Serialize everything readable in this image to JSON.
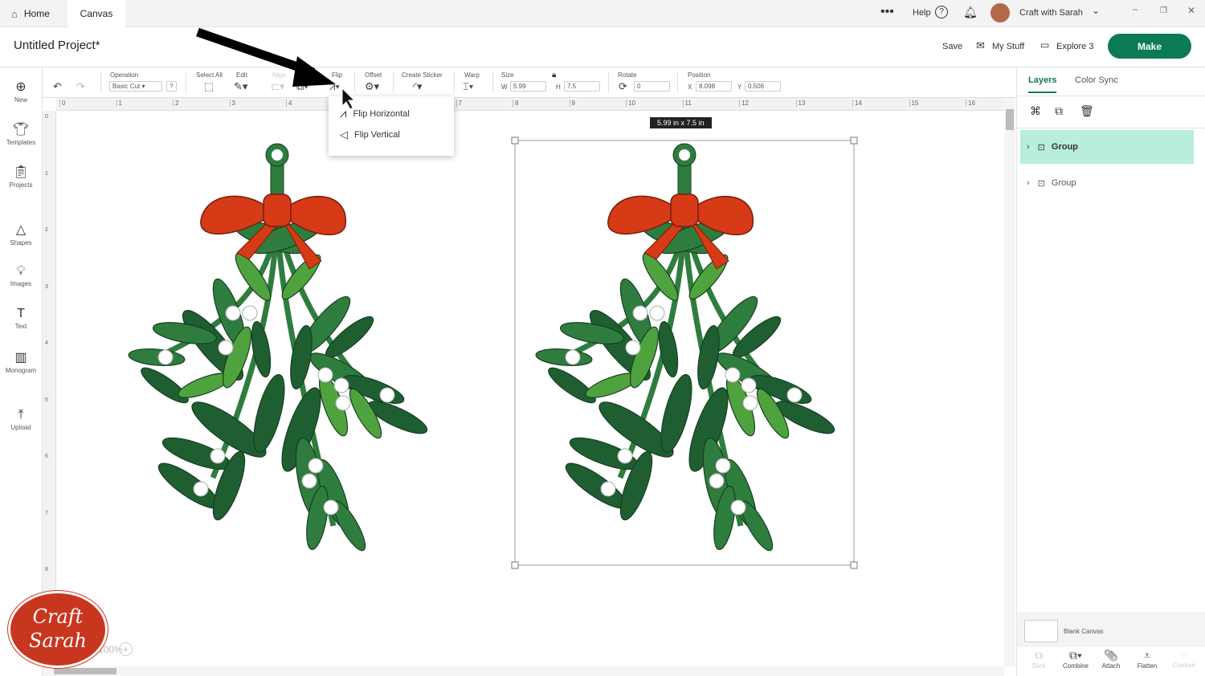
{
  "tabs": [
    {
      "label": "Home"
    },
    {
      "label": "Canvas"
    }
  ],
  "topbar": {
    "help": "Help",
    "user": "Craft with Sarah"
  },
  "header": {
    "title": "Untitled Project*",
    "save": "Save",
    "my_stuff": "My Stuff",
    "machine": "Explore 3",
    "make": "Make"
  },
  "toolbar": {
    "operation_label": "Operation",
    "operation_value": "Basic Cut",
    "help": "?",
    "select_all": "Select All",
    "edit": "Edit",
    "align": "Align",
    "flip": "Flip",
    "offset": "Offset",
    "create_sticker": "Create Sticker",
    "warp": "Warp",
    "size": "Size",
    "w_label": "W",
    "w": "5.99",
    "h_label": "H",
    "h": "7.5",
    "rotate": "Rotate",
    "rotate_value": "0",
    "position": "Position",
    "x_label": "X",
    "x": "8.098",
    "y_label": "Y",
    "y": "0.506"
  },
  "flip_menu": {
    "items": [
      {
        "label": "Flip Horizontal"
      },
      {
        "label": "Flip Vertical"
      }
    ]
  },
  "sidebar": {
    "items": [
      {
        "label": "New",
        "icon": "plus-circle"
      },
      {
        "label": "Templates",
        "icon": "shirt"
      },
      {
        "label": "Projects",
        "icon": "clipboard"
      },
      {
        "label": "Shapes",
        "icon": "shapes"
      },
      {
        "label": "Images",
        "icon": "bulb"
      },
      {
        "label": "Text",
        "icon": "text"
      },
      {
        "label": "Monogram",
        "icon": "monogram"
      },
      {
        "label": "Upload",
        "icon": "upload"
      }
    ]
  },
  "ruler": {
    "top": [
      "0",
      "1",
      "2",
      "3",
      "4",
      "5",
      "6",
      "7",
      "8",
      "9",
      "10",
      "11",
      "12",
      "13",
      "14",
      "15",
      "16"
    ],
    "left": [
      "0",
      "1",
      "2",
      "3",
      "4",
      "5",
      "6",
      "7",
      "8"
    ]
  },
  "canvas": {
    "size_tooltip": "5.99  in x 7.5  in",
    "zoom": "100%"
  },
  "right_panel": {
    "tabs": [
      {
        "label": "Layers"
      },
      {
        "label": "Color Sync"
      }
    ],
    "layers": [
      {
        "label": "Group",
        "selected": true
      },
      {
        "label": "Group",
        "selected": false
      }
    ],
    "blank_canvas": "Blank Canvas",
    "bottom": [
      {
        "label": "Slice",
        "enabled": false
      },
      {
        "label": "Combine",
        "enabled": true
      },
      {
        "label": "Attach",
        "enabled": true
      },
      {
        "label": "Flatten",
        "enabled": true
      },
      {
        "label": "Contour",
        "enabled": false
      }
    ]
  },
  "watermark": "Craft with Sarah",
  "colors": {
    "accent": "#0b7a55",
    "layer_selected": "#b8eedb",
    "ribbon": "#d63a16",
    "leaf_dark": "#1f5e31",
    "leaf_mid": "#2f7d3e",
    "leaf_light": "#4fa33e"
  }
}
